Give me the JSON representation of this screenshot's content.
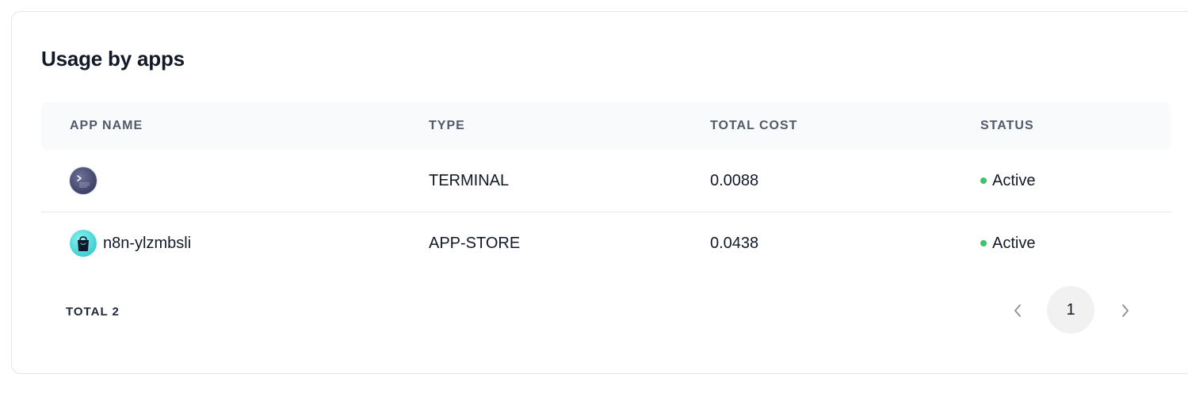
{
  "card": {
    "title": "Usage by apps"
  },
  "table": {
    "columns": [
      "APP NAME",
      "TYPE",
      "TOTAL COST",
      "STATUS"
    ],
    "rows": [
      {
        "icon": "terminal-app-icon",
        "name": "",
        "type": "TERMINAL",
        "total_cost": "0.0088",
        "status": "Active"
      },
      {
        "icon": "app-store-bag-icon",
        "name": "n8n-ylzmbsli",
        "type": "APP-STORE",
        "total_cost": "0.0438",
        "status": "Active"
      }
    ]
  },
  "pagination": {
    "total_label": "TOTAL 2",
    "current_page": "1"
  },
  "colors": {
    "status_active": "#3cc36b",
    "header_bg": "#f9fafb"
  }
}
